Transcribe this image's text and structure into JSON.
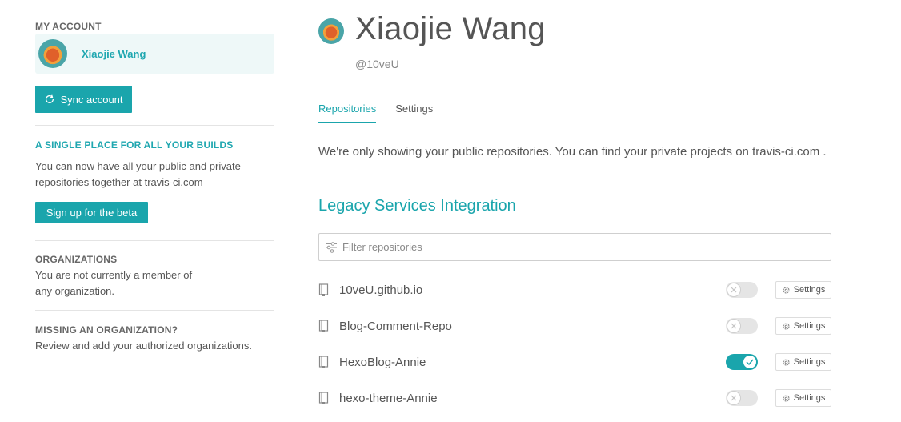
{
  "sidebar": {
    "account_heading": "MY ACCOUNT",
    "account_name": "Xiaojie Wang",
    "sync_label": "Sync account",
    "beta_heading": "A SINGLE PLACE FOR ALL YOUR BUILDS",
    "beta_text": "You can now have all your public and private repositories together at travis-ci.com",
    "beta_button": "Sign up for the beta",
    "org_heading": "ORGANIZATIONS",
    "org_text": "You are not currently a member of any organization.",
    "missing_heading": "MISSING AN ORGANIZATION?",
    "missing_link": "Review and add",
    "missing_text": " your authorized organizations."
  },
  "profile": {
    "name": "Xiaojie Wang",
    "handle": "@10veU"
  },
  "tabs": [
    {
      "label": "Repositories",
      "active": true
    },
    {
      "label": "Settings",
      "active": false
    }
  ],
  "notice": {
    "text": "We're only showing your public repositories. You can find your private projects on ",
    "link": "travis-ci.com",
    "suffix": " ."
  },
  "section_title": "Legacy Services Integration",
  "filter": {
    "placeholder": "Filter repositories"
  },
  "repos": [
    {
      "name": "10veU.github.io",
      "enabled": false,
      "settings_label": "Settings"
    },
    {
      "name": "Blog-Comment-Repo",
      "enabled": false,
      "settings_label": "Settings"
    },
    {
      "name": "HexoBlog-Annie",
      "enabled": true,
      "settings_label": "Settings"
    },
    {
      "name": "hexo-theme-Annie",
      "enabled": false,
      "settings_label": "Settings"
    }
  ],
  "colors": {
    "accent": "#1aa5ac",
    "card_bg": "#eef8f8"
  },
  "icons": {
    "sync": "sync-icon",
    "filter": "filter-icon",
    "repo": "repo-icon",
    "gear": "gear-icon",
    "check": "check-icon",
    "close": "close-icon"
  }
}
